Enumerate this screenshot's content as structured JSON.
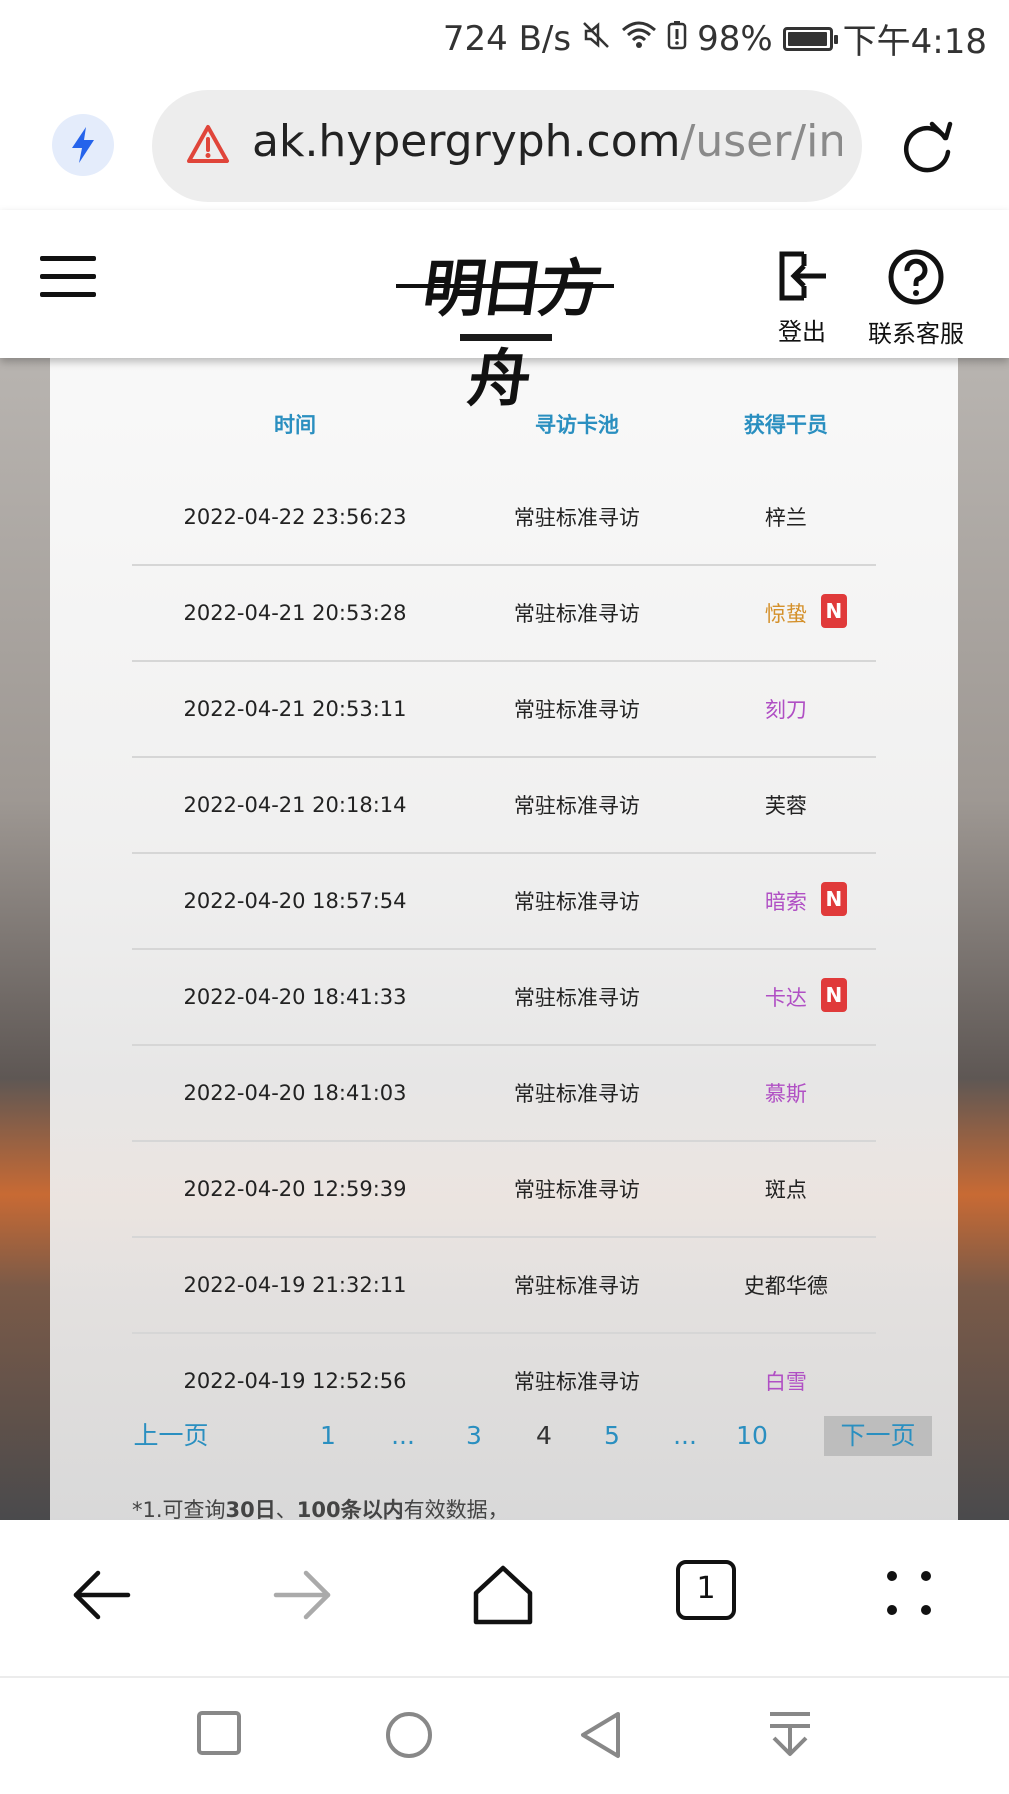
{
  "status_bar": {
    "net_speed": "724 B/s",
    "battery": "98%",
    "battery_level": 0.98,
    "time": "下午4:18",
    "icons": [
      "mute-icon",
      "wifi-icon",
      "battery-alert-icon",
      "battery-icon"
    ]
  },
  "url_bar": {
    "domain": "ak.hypergryph.com",
    "path": "/user/inqu",
    "icons": [
      "bolt-icon",
      "warning-icon",
      "reload-icon"
    ]
  },
  "site_header": {
    "logo_text": "明日方舟",
    "logout_label": "登出",
    "support_label": "联系客服",
    "icons": [
      "hamburger-menu-icon",
      "logout-icon",
      "help-icon"
    ]
  },
  "table": {
    "headers": [
      "时间",
      "寻访卡池",
      "获得干员"
    ],
    "rows": [
      {
        "time": "2022-04-22 23:56:23",
        "pool": "常驻标准寻访",
        "operator": "梓兰",
        "color": "#222222",
        "new": ""
      },
      {
        "time": "2022-04-21 20:53:28",
        "pool": "常驻标准寻访",
        "operator": "惊蛰",
        "color": "#d4902a",
        "new": "N"
      },
      {
        "time": "2022-04-21 20:53:11",
        "pool": "常驻标准寻访",
        "operator": "刻刀",
        "color": "#b04fc4",
        "new": ""
      },
      {
        "time": "2022-04-21 20:18:14",
        "pool": "常驻标准寻访",
        "operator": "芙蓉",
        "color": "#222222",
        "new": ""
      },
      {
        "time": "2022-04-20 18:57:54",
        "pool": "常驻标准寻访",
        "operator": "暗索",
        "color": "#b04fc4",
        "new": "N"
      },
      {
        "time": "2022-04-20 18:41:33",
        "pool": "常驻标准寻访",
        "operator": "卡达",
        "color": "#b04fc4",
        "new": "N"
      },
      {
        "time": "2022-04-20 18:41:03",
        "pool": "常驻标准寻访",
        "operator": "慕斯",
        "color": "#b04fc4",
        "new": ""
      },
      {
        "time": "2022-04-20 12:59:39",
        "pool": "常驻标准寻访",
        "operator": "斑点",
        "color": "#222222",
        "new": ""
      },
      {
        "time": "2022-04-19 21:32:11",
        "pool": "常驻标准寻访",
        "operator": "史都华德",
        "color": "#222222",
        "new": ""
      },
      {
        "time": "2022-04-19 12:52:56",
        "pool": "常驻标准寻访",
        "operator": "白雪",
        "color": "#b04fc4",
        "new": ""
      }
    ]
  },
  "pagination": {
    "prev": "上一页",
    "next": "下一页",
    "pages": [
      "1",
      "...",
      "3",
      "4",
      "5",
      "...",
      "10"
    ],
    "current": "4"
  },
  "note": {
    "prefix": "*1.可查询",
    "bold1": "30日",
    "mid": "、",
    "bold2": "100条以内",
    "suffix": "有效数据，"
  },
  "browser_toolbar": {
    "tab_count": "1",
    "icons": [
      "back-arrow-icon",
      "forward-arrow-icon",
      "home-icon",
      "tabs-icon",
      "menu-dots-icon"
    ]
  },
  "system_nav": {
    "icons": [
      "recents-square-icon",
      "home-circle-icon",
      "back-triangle-icon",
      "notification-pull-icon"
    ]
  },
  "colors": {
    "accent": "#2a8fc0",
    "new_badge": "#e03a3a",
    "rarity_4": "#b04fc4",
    "rarity_5": "#d4902a"
  }
}
